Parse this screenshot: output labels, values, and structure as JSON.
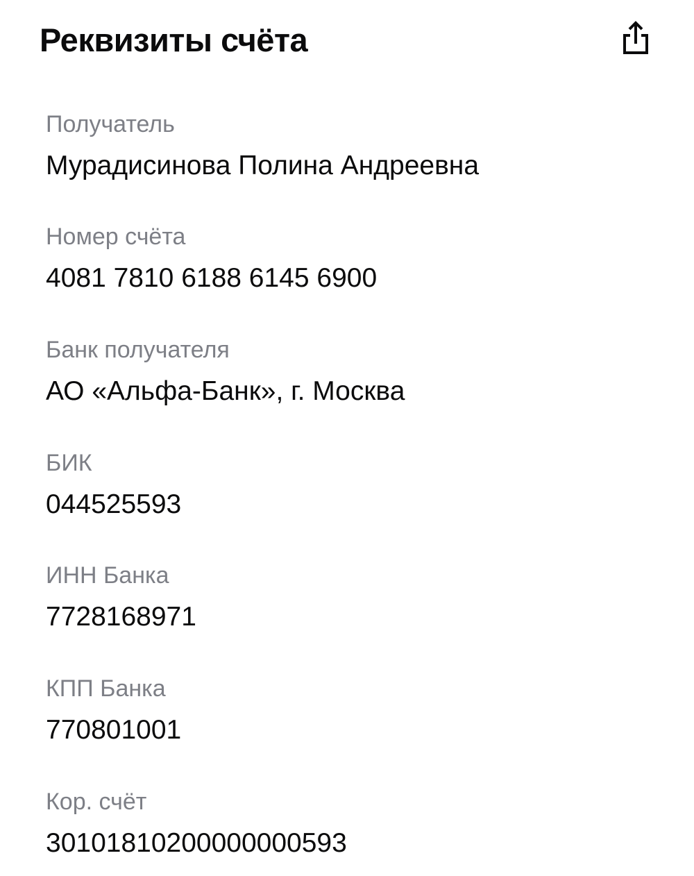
{
  "header": {
    "title": "Реквизиты счёта",
    "share_icon": "share-icon"
  },
  "fields": [
    {
      "label": "Получатель",
      "value": "Мурадисинова Полина Андреевна"
    },
    {
      "label": "Номер счёта",
      "value": "4081 7810 6188 6145 6900"
    },
    {
      "label": "Банк получателя",
      "value": "АО «Альфа-Банк», г. Москва"
    },
    {
      "label": "БИК",
      "value": "044525593"
    },
    {
      "label": "ИНН Банка",
      "value": "7728168971"
    },
    {
      "label": "КПП Банка",
      "value": "770801001"
    },
    {
      "label": "Кор. счёт",
      "value": "30101810200000000593"
    }
  ],
  "colors": {
    "text_primary": "#0b0b0c",
    "text_secondary": "#7d7f86",
    "background": "#ffffff"
  }
}
